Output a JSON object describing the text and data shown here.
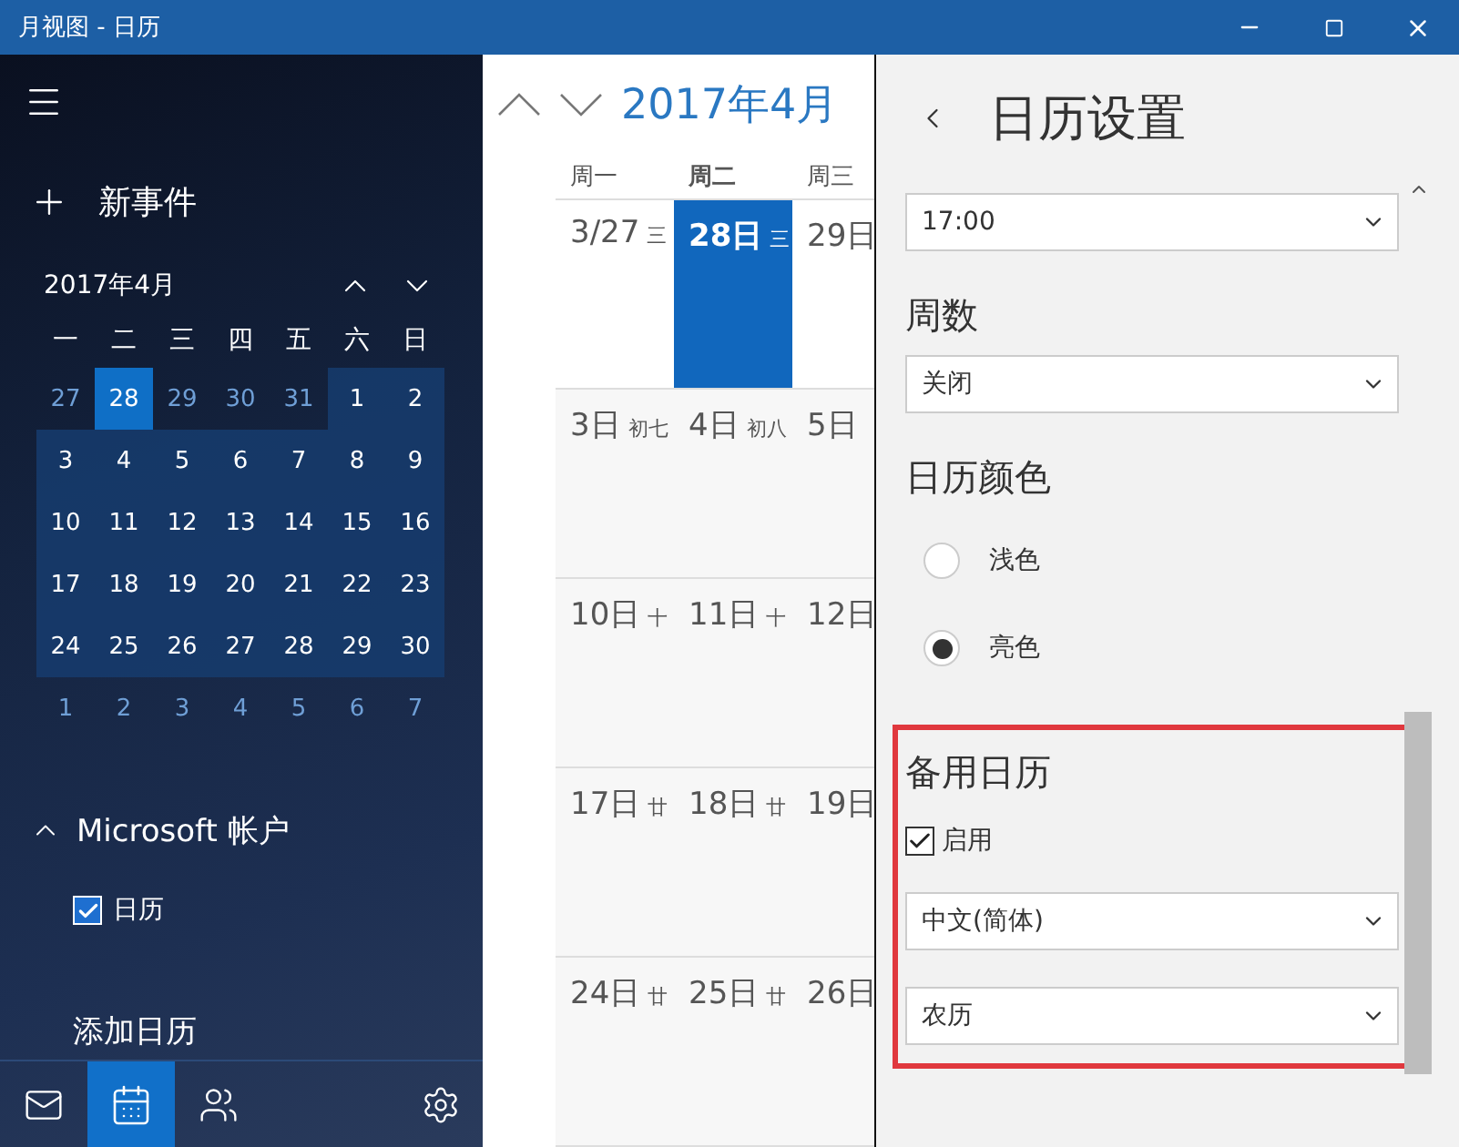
{
  "window": {
    "title": "月视图 - 日历"
  },
  "sidebar": {
    "new_event": "新事件",
    "mini_calendar": {
      "title": "2017年4月",
      "weekdays": [
        "一",
        "二",
        "三",
        "四",
        "五",
        "六",
        "日"
      ],
      "days": [
        {
          "day": "27",
          "in_month": false,
          "selected": false
        },
        {
          "day": "28",
          "in_month": false,
          "selected": true
        },
        {
          "day": "29",
          "in_month": false,
          "selected": false
        },
        {
          "day": "30",
          "in_month": false,
          "selected": false
        },
        {
          "day": "31",
          "in_month": false,
          "selected": false
        },
        {
          "day": "1",
          "in_month": true,
          "selected": false
        },
        {
          "day": "2",
          "in_month": true,
          "selected": false
        },
        {
          "day": "3",
          "in_month": true,
          "selected": false
        },
        {
          "day": "4",
          "in_month": true,
          "selected": false
        },
        {
          "day": "5",
          "in_month": true,
          "selected": false
        },
        {
          "day": "6",
          "in_month": true,
          "selected": false
        },
        {
          "day": "7",
          "in_month": true,
          "selected": false
        },
        {
          "day": "8",
          "in_month": true,
          "selected": false
        },
        {
          "day": "9",
          "in_month": true,
          "selected": false
        },
        {
          "day": "10",
          "in_month": true,
          "selected": false
        },
        {
          "day": "11",
          "in_month": true,
          "selected": false
        },
        {
          "day": "12",
          "in_month": true,
          "selected": false
        },
        {
          "day": "13",
          "in_month": true,
          "selected": false
        },
        {
          "day": "14",
          "in_month": true,
          "selected": false
        },
        {
          "day": "15",
          "in_month": true,
          "selected": false
        },
        {
          "day": "16",
          "in_month": true,
          "selected": false
        },
        {
          "day": "17",
          "in_month": true,
          "selected": false
        },
        {
          "day": "18",
          "in_month": true,
          "selected": false
        },
        {
          "day": "19",
          "in_month": true,
          "selected": false
        },
        {
          "day": "20",
          "in_month": true,
          "selected": false
        },
        {
          "day": "21",
          "in_month": true,
          "selected": false
        },
        {
          "day": "22",
          "in_month": true,
          "selected": false
        },
        {
          "day": "23",
          "in_month": true,
          "selected": false
        },
        {
          "day": "24",
          "in_month": true,
          "selected": false
        },
        {
          "day": "25",
          "in_month": true,
          "selected": false
        },
        {
          "day": "26",
          "in_month": true,
          "selected": false
        },
        {
          "day": "27",
          "in_month": true,
          "selected": false
        },
        {
          "day": "28",
          "in_month": true,
          "selected": false
        },
        {
          "day": "29",
          "in_month": true,
          "selected": false
        },
        {
          "day": "30",
          "in_month": true,
          "selected": false
        },
        {
          "day": "1",
          "in_month": false,
          "selected": false
        },
        {
          "day": "2",
          "in_month": false,
          "selected": false
        },
        {
          "day": "3",
          "in_month": false,
          "selected": false
        },
        {
          "day": "4",
          "in_month": false,
          "selected": false
        },
        {
          "day": "5",
          "in_month": false,
          "selected": false
        },
        {
          "day": "6",
          "in_month": false,
          "selected": false
        },
        {
          "day": "7",
          "in_month": false,
          "selected": false
        }
      ]
    },
    "account": {
      "name": "Microsoft 帐户",
      "expanded": true,
      "calendars": [
        {
          "label": "日历",
          "checked": true
        }
      ]
    },
    "add_calendar": "添加日历",
    "nav": [
      {
        "kind": "mail",
        "selected": false
      },
      {
        "kind": "calendar",
        "selected": true
      },
      {
        "kind": "people",
        "selected": false
      },
      {
        "kind": "settings",
        "selected": false
      }
    ]
  },
  "month_view": {
    "title": "2017年4月",
    "weekdays": [
      {
        "label": "周一",
        "selected": false
      },
      {
        "label": "周二",
        "selected": true
      },
      {
        "label": "周三",
        "selected": false
      }
    ],
    "weeks": [
      [
        {
          "date": "3/27",
          "lunar": "三",
          "today": false
        },
        {
          "date": "28日",
          "lunar": "三",
          "today": true
        },
        {
          "date": "29日",
          "today": false
        }
      ],
      [
        {
          "date": "3日",
          "lunar": "初七",
          "today": false
        },
        {
          "date": "4日",
          "lunar": "初八",
          "today": false
        },
        {
          "date": "5日",
          "today": false
        }
      ],
      [
        {
          "date": "10日",
          "lunar": "十",
          "today": false
        },
        {
          "date": "11日",
          "lunar": "十",
          "today": false
        },
        {
          "date": "12日",
          "today": false
        }
      ],
      [
        {
          "date": "17日",
          "lunar": "廿",
          "today": false
        },
        {
          "date": "18日",
          "lunar": "廿",
          "today": false
        },
        {
          "date": "19日",
          "today": false
        }
      ],
      [
        {
          "date": "24日",
          "lunar": "廿",
          "today": false
        },
        {
          "date": "25日",
          "lunar": "廿",
          "today": false
        },
        {
          "date": "26日",
          "today": false
        }
      ]
    ]
  },
  "settings": {
    "title": "日历设置",
    "sections": [
      {
        "kind": "select",
        "value": "17:00"
      },
      {
        "kind": "heading",
        "text": "周数"
      },
      {
        "kind": "select",
        "value": "关闭"
      },
      {
        "kind": "heading",
        "text": "日历颜色"
      },
      {
        "kind": "radio",
        "label": "浅色",
        "selected": false
      },
      {
        "kind": "radio",
        "label": "亮色",
        "selected": true
      }
    ],
    "alternate": {
      "highlighted": true,
      "heading": "备用日历",
      "enable": {
        "label": "启用",
        "checked": true
      },
      "language": "中文(简体)",
      "calendar": "农历"
    }
  }
}
